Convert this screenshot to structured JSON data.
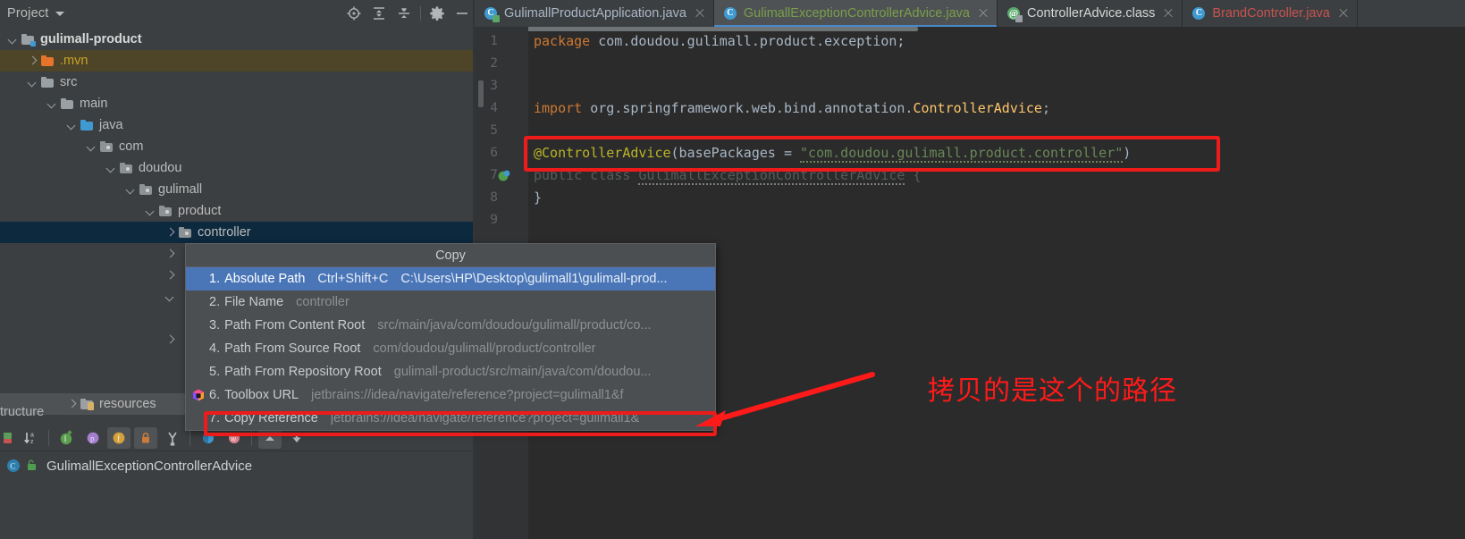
{
  "project_panel": {
    "title": "Project",
    "tools": [
      {
        "name": "locate-icon",
        "label": "Select Opened File"
      },
      {
        "name": "expand-all-icon",
        "label": "Expand All"
      },
      {
        "name": "collapse-all-icon",
        "label": "Collapse All"
      },
      {
        "name": "gear-icon",
        "label": "Settings"
      },
      {
        "name": "minimize-icon",
        "label": "Hide"
      }
    ],
    "tree": [
      {
        "label": "gulimall-product",
        "depth": 0,
        "state": "expanded",
        "icon": "module-folder",
        "bold": true,
        "row_style": "none"
      },
      {
        "label": ".mvn",
        "depth": 1,
        "state": "collapsed",
        "icon": "orange-folder",
        "bold": false,
        "row_style": "olive"
      },
      {
        "label": "src",
        "depth": 1,
        "state": "expanded",
        "icon": "gray-folder",
        "bold": false,
        "row_style": "none"
      },
      {
        "label": "main",
        "depth": 2,
        "state": "expanded",
        "icon": "gray-folder",
        "bold": false,
        "row_style": "none"
      },
      {
        "label": "java",
        "depth": 3,
        "state": "expanded",
        "icon": "blue-folder",
        "bold": false,
        "row_style": "none"
      },
      {
        "label": "com",
        "depth": 4,
        "state": "expanded",
        "icon": "package",
        "bold": false,
        "row_style": "none"
      },
      {
        "label": "doudou",
        "depth": 5,
        "state": "expanded",
        "icon": "package",
        "bold": false,
        "row_style": "none"
      },
      {
        "label": "gulimall",
        "depth": 6,
        "state": "expanded",
        "icon": "package",
        "bold": false,
        "row_style": "none"
      },
      {
        "label": "product",
        "depth": 7,
        "state": "expanded",
        "icon": "package",
        "bold": false,
        "row_style": "none"
      },
      {
        "label": "controller",
        "depth": 8,
        "state": "collapsed",
        "icon": "package",
        "bold": false,
        "row_style": "blue"
      },
      {
        "label": "",
        "depth": 8,
        "state": "collapsed",
        "icon": "none",
        "bold": false,
        "row_style": "none"
      },
      {
        "label": "",
        "depth": 8,
        "state": "collapsed",
        "icon": "none",
        "bold": false,
        "row_style": "none"
      },
      {
        "label": "",
        "depth": 8,
        "state": "expanded",
        "icon": "none",
        "bold": false,
        "row_style": "none"
      },
      {
        "label": "",
        "depth": 8,
        "state": "none",
        "icon": "none",
        "bold": false,
        "row_style": "none"
      },
      {
        "label": "",
        "depth": 8,
        "state": "collapsed",
        "icon": "none",
        "bold": false,
        "row_style": "none"
      }
    ],
    "resources_row": {
      "label": "resources",
      "state": "collapsed",
      "icon": "resources-folder"
    }
  },
  "copy_menu": {
    "title": "Copy",
    "items": [
      {
        "index": "1.",
        "label": "Absolute Path",
        "shortcut": "Ctrl+Shift+C",
        "value": "C:\\Users\\HP\\Desktop\\gulimall1\\gulimall-prod...",
        "highlighted": true,
        "icon": "none"
      },
      {
        "index": "2.",
        "label": "File Name",
        "shortcut": "",
        "value": "controller",
        "highlighted": false,
        "icon": "none"
      },
      {
        "index": "3.",
        "label": "Path From Content Root",
        "shortcut": "",
        "value": "src/main/java/com/doudou/gulimall/product/co...",
        "highlighted": false,
        "icon": "none"
      },
      {
        "index": "4.",
        "label": "Path From Source Root",
        "shortcut": "",
        "value": "com/doudou/gulimall/product/controller",
        "highlighted": false,
        "icon": "none"
      },
      {
        "index": "5.",
        "label": "Path From Repository Root",
        "shortcut": "",
        "value": "gulimall-product/src/main/java/com/doudou...",
        "highlighted": false,
        "icon": "none"
      },
      {
        "index": "6.",
        "label": "Toolbox URL",
        "shortcut": "",
        "value": "jetbrains://idea/navigate/reference?project=gulimall1&fqn...",
        "highlighted": false,
        "icon": "toolbox-icon"
      },
      {
        "index": "7.",
        "label": "Copy Reference",
        "shortcut": "",
        "value": "jetbrains://idea/navigate/reference?project=gulimall1&...",
        "highlighted": false,
        "icon": "none"
      }
    ]
  },
  "editor": {
    "tabs": [
      {
        "label": "GulimallProductApplication.java",
        "active": false,
        "icon_letter": "C",
        "icon_color": "#3f9ad1",
        "badge_color": "#59a869",
        "text_color": "#a9b7c6"
      },
      {
        "label": "GulimallExceptionControllerAdvice.java",
        "active": true,
        "icon_letter": "C",
        "icon_color": "#3f9ad1",
        "badge_color": "",
        "text_color": "#7b9e4a"
      },
      {
        "label": "ControllerAdvice.class",
        "active": false,
        "icon_letter": "@",
        "icon_color": "#59a869",
        "badge_color": "#9aa0a6",
        "text_color": "#d6d6d6"
      },
      {
        "label": "BrandController.java",
        "active": false,
        "icon_letter": "C",
        "icon_color": "#3f9ad1",
        "badge_color": "",
        "text_color": "#c75450"
      }
    ],
    "line_numbers": [
      "1",
      "2",
      "3",
      "4",
      "5",
      "6",
      "7",
      "8",
      "9"
    ],
    "code": {
      "l1_kw": "package",
      "l1_rest": " com.doudou.gulimall.product.exception;",
      "l4_kw": "import",
      "l4_rest": " org.springframework.web.bind.annotation.",
      "l4_cls": "ControllerAdvice",
      "l4_end": ";",
      "l6_ann": "@ControllerAdvice",
      "l6_p1": "(basePackages = ",
      "l6_str": "\"com.doudou.gulimall.product.controller\"",
      "l6_p2": ")",
      "l7_kw": "public class ",
      "l7_name": "GulimallExceptionControllerAdvice",
      "l7_brace": " {",
      "l8": "}"
    }
  },
  "bottom_bar": {
    "structure_label": "tructure",
    "breadcrumb": "GulimallExceptionControllerAdvice",
    "tools": [
      {
        "name": "build-variants-icon"
      },
      {
        "name": "sort-alphabetically-icon"
      },
      {
        "name": "show-inherited-icon"
      },
      {
        "name": "show-properties-icon"
      },
      {
        "name": "show-fields-icon"
      },
      {
        "name": "show-non-public-icon"
      },
      {
        "name": "group-by-icon"
      },
      {
        "name": "version-control-icon"
      },
      {
        "name": "run-dashboard-icon"
      },
      {
        "name": "expand-icon"
      },
      {
        "name": "collapse-icon"
      }
    ]
  },
  "annotation": {
    "text": "拷贝的是这个的路径",
    "color": "#ff1a1a"
  }
}
